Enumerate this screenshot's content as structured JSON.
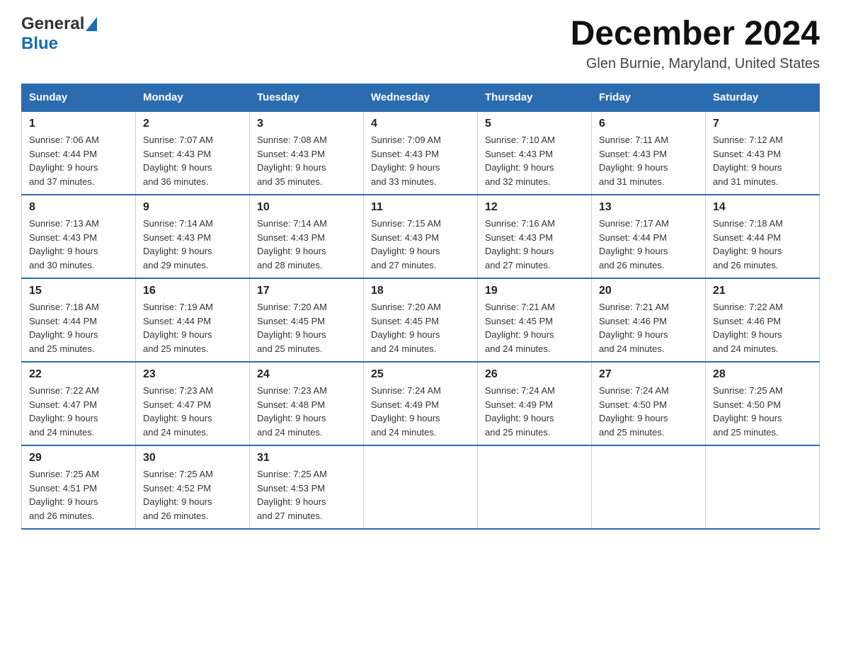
{
  "header": {
    "logo_general": "General",
    "logo_blue": "Blue",
    "month_title": "December 2024",
    "location": "Glen Burnie, Maryland, United States"
  },
  "days_of_week": [
    "Sunday",
    "Monday",
    "Tuesday",
    "Wednesday",
    "Thursday",
    "Friday",
    "Saturday"
  ],
  "weeks": [
    [
      {
        "day": "1",
        "sunrise": "7:06 AM",
        "sunset": "4:44 PM",
        "daylight": "9 hours and 37 minutes."
      },
      {
        "day": "2",
        "sunrise": "7:07 AM",
        "sunset": "4:43 PM",
        "daylight": "9 hours and 36 minutes."
      },
      {
        "day": "3",
        "sunrise": "7:08 AM",
        "sunset": "4:43 PM",
        "daylight": "9 hours and 35 minutes."
      },
      {
        "day": "4",
        "sunrise": "7:09 AM",
        "sunset": "4:43 PM",
        "daylight": "9 hours and 33 minutes."
      },
      {
        "day": "5",
        "sunrise": "7:10 AM",
        "sunset": "4:43 PM",
        "daylight": "9 hours and 32 minutes."
      },
      {
        "day": "6",
        "sunrise": "7:11 AM",
        "sunset": "4:43 PM",
        "daylight": "9 hours and 31 minutes."
      },
      {
        "day": "7",
        "sunrise": "7:12 AM",
        "sunset": "4:43 PM",
        "daylight": "9 hours and 31 minutes."
      }
    ],
    [
      {
        "day": "8",
        "sunrise": "7:13 AM",
        "sunset": "4:43 PM",
        "daylight": "9 hours and 30 minutes."
      },
      {
        "day": "9",
        "sunrise": "7:14 AM",
        "sunset": "4:43 PM",
        "daylight": "9 hours and 29 minutes."
      },
      {
        "day": "10",
        "sunrise": "7:14 AM",
        "sunset": "4:43 PM",
        "daylight": "9 hours and 28 minutes."
      },
      {
        "day": "11",
        "sunrise": "7:15 AM",
        "sunset": "4:43 PM",
        "daylight": "9 hours and 27 minutes."
      },
      {
        "day": "12",
        "sunrise": "7:16 AM",
        "sunset": "4:43 PM",
        "daylight": "9 hours and 27 minutes."
      },
      {
        "day": "13",
        "sunrise": "7:17 AM",
        "sunset": "4:44 PM",
        "daylight": "9 hours and 26 minutes."
      },
      {
        "day": "14",
        "sunrise": "7:18 AM",
        "sunset": "4:44 PM",
        "daylight": "9 hours and 26 minutes."
      }
    ],
    [
      {
        "day": "15",
        "sunrise": "7:18 AM",
        "sunset": "4:44 PM",
        "daylight": "9 hours and 25 minutes."
      },
      {
        "day": "16",
        "sunrise": "7:19 AM",
        "sunset": "4:44 PM",
        "daylight": "9 hours and 25 minutes."
      },
      {
        "day": "17",
        "sunrise": "7:20 AM",
        "sunset": "4:45 PM",
        "daylight": "9 hours and 25 minutes."
      },
      {
        "day": "18",
        "sunrise": "7:20 AM",
        "sunset": "4:45 PM",
        "daylight": "9 hours and 24 minutes."
      },
      {
        "day": "19",
        "sunrise": "7:21 AM",
        "sunset": "4:45 PM",
        "daylight": "9 hours and 24 minutes."
      },
      {
        "day": "20",
        "sunrise": "7:21 AM",
        "sunset": "4:46 PM",
        "daylight": "9 hours and 24 minutes."
      },
      {
        "day": "21",
        "sunrise": "7:22 AM",
        "sunset": "4:46 PM",
        "daylight": "9 hours and 24 minutes."
      }
    ],
    [
      {
        "day": "22",
        "sunrise": "7:22 AM",
        "sunset": "4:47 PM",
        "daylight": "9 hours and 24 minutes."
      },
      {
        "day": "23",
        "sunrise": "7:23 AM",
        "sunset": "4:47 PM",
        "daylight": "9 hours and 24 minutes."
      },
      {
        "day": "24",
        "sunrise": "7:23 AM",
        "sunset": "4:48 PM",
        "daylight": "9 hours and 24 minutes."
      },
      {
        "day": "25",
        "sunrise": "7:24 AM",
        "sunset": "4:49 PM",
        "daylight": "9 hours and 24 minutes."
      },
      {
        "day": "26",
        "sunrise": "7:24 AM",
        "sunset": "4:49 PM",
        "daylight": "9 hours and 25 minutes."
      },
      {
        "day": "27",
        "sunrise": "7:24 AM",
        "sunset": "4:50 PM",
        "daylight": "9 hours and 25 minutes."
      },
      {
        "day": "28",
        "sunrise": "7:25 AM",
        "sunset": "4:50 PM",
        "daylight": "9 hours and 25 minutes."
      }
    ],
    [
      {
        "day": "29",
        "sunrise": "7:25 AM",
        "sunset": "4:51 PM",
        "daylight": "9 hours and 26 minutes."
      },
      {
        "day": "30",
        "sunrise": "7:25 AM",
        "sunset": "4:52 PM",
        "daylight": "9 hours and 26 minutes."
      },
      {
        "day": "31",
        "sunrise": "7:25 AM",
        "sunset": "4:53 PM",
        "daylight": "9 hours and 27 minutes."
      },
      null,
      null,
      null,
      null
    ]
  ],
  "labels": {
    "sunrise": "Sunrise:",
    "sunset": "Sunset:",
    "daylight": "Daylight:"
  }
}
